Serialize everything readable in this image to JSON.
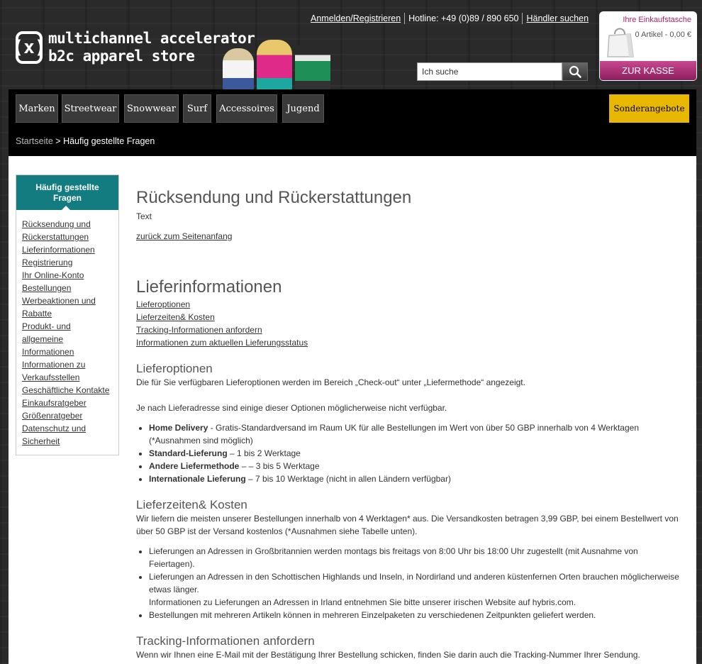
{
  "brand": {
    "logo_line1": "multichannel accelerator",
    "logo_line2": "b2c apparel store",
    "logo_mark": "(x)"
  },
  "header": {
    "login_link": "Anmelden/Registrieren",
    "hotline": "Hotline: +49 (0)89 / 890 650",
    "dealer_link": "Händler suchen"
  },
  "search": {
    "placeholder": "Ich suche",
    "value": "Ich suche",
    "icon": "search-icon"
  },
  "cart": {
    "title": "Ihre Einkaufstasche",
    "count": "0 Artikel - 0,00 €",
    "checkout": "ZUR KASSE",
    "icon": "shopping-bag-icon"
  },
  "nav": {
    "items": [
      "Marken",
      "Streetwear",
      "Snowwear",
      "Surf",
      "Accessoires",
      "Jugend"
    ],
    "special": "Sonderangebote"
  },
  "breadcrumb": {
    "home": "Startseite",
    "separator": " > ",
    "current": "Häufig gestellte Fragen"
  },
  "sidebar": {
    "title": "Häufig gestellte Fragen",
    "links": [
      "Rücksendung und Rückerstattungen",
      "Lieferinformationen",
      "Registrierung",
      "Ihr Online-Konto",
      "Bestellungen",
      "Werbeaktionen und Rabatte",
      "Produkt- und allgemeine Informationen",
      "Informationen zu Verkaufsstellen",
      "Geschäftliche Kontakte",
      "Einkaufsratgeber",
      "Größenratgeber",
      "Datenschutz und Sicherheit"
    ]
  },
  "main": {
    "returns": {
      "title": "Rücksendung und Rückerstattungen",
      "text": "Text",
      "back_link": "zurück zum Seitenanfang"
    },
    "delivery": {
      "title": "Lieferinformationen",
      "links": [
        "Lieferoptionen",
        "Lieferzeiten& Kosten",
        "Tracking-Informationen anfordern",
        "Informationen zum aktuellen Lieferungsstatus"
      ]
    },
    "options": {
      "title": "Lieferoptionen",
      "p1": "Die für Sie verfügbaren Lieferoptionen werden im Bereich „Check-out“ unter „Liefermethode“ angezeigt.",
      "p2": "Je nach Lieferadresse sind einige dieser Optionen möglicherweise nicht verfügbar.",
      "items": [
        {
          "label": "Home Delivery",
          "text": " - Gratis-Standardversand im Raum UK für alle Bestellungen im Wert von über 50 GBP innerhalb von 4 Werktagen (*Ausnahmen sind möglich)"
        },
        {
          "label": "Standard-Lieferung",
          "text": " – 1 bis 2 Werktage"
        },
        {
          "label": "Andere Liefermethode",
          "text": " – – 3 bis 5 Werktage"
        },
        {
          "label": "Internationale Lieferung",
          "text": " – 7 bis 10 Werktage (nicht in allen Ländern verfügbar)"
        }
      ]
    },
    "times": {
      "title": "Lieferzeiten& Kosten",
      "p1": "Wir liefern die meisten unserer Bestellungen innerhalb von 4 Werktagen* aus. Die Versandkosten betragen 3,99 GBP, bei einem Bestellwert von über 50 GBP ist der Versand kostenlos (*Ausnahmen siehe Tabelle unten).",
      "items": [
        "Lieferungen an Adressen in Großbritannien werden montags bis freitags von 8:00 Uhr bis 18:00 Uhr zugestellt (mit Ausnahme von Feiertagen).",
        "Lieferungen an Adressen in den Schottischen Highlands und Inseln, in Nordirland und anderen küstenfernen Orten brauchen möglicherweise etwas länger.",
        "Informationen zu Lieferungen an Adressen in Irland entnehmen Sie bitte unserer irischen Website auf hybris.com.",
        "Bestellungen mit mehreren Artikeln können in mehreren Einzelpaketen zu verschiedenen Zeitpunkten geliefert werden."
      ]
    },
    "tracking": {
      "title": "Tracking-Informationen anfordern",
      "p1": "Wenn wir Ihnen eine E-Mail mit der Bestätigung Ihrer Bestellung schicken, finden Sie darin auch die Tracking-Nummer Ihrer Sendung."
    }
  }
}
